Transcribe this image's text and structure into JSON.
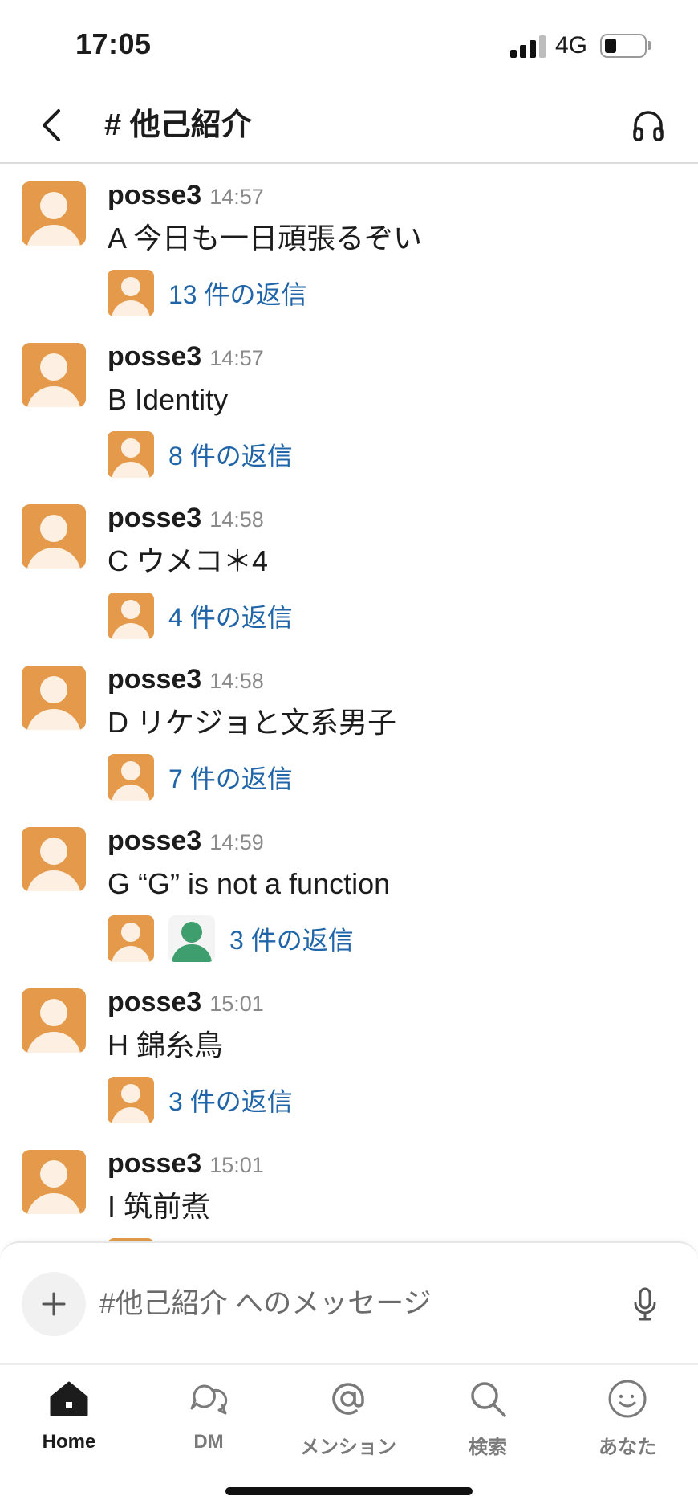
{
  "status_bar": {
    "time": "17:05",
    "network": "4G"
  },
  "header": {
    "channel_title": "# 他己紹介"
  },
  "messages": [
    {
      "user": "posse3",
      "time": "14:57",
      "text": "A  今日も一日頑張るぞい",
      "reply_text": "13 件の返信",
      "participants": [
        "orange"
      ]
    },
    {
      "user": "posse3",
      "time": "14:57",
      "text": "B  Identity",
      "reply_text": "8 件の返信",
      "participants": [
        "orange"
      ]
    },
    {
      "user": "posse3",
      "time": "14:58",
      "text": "C  ウメコ＊4",
      "reply_text": "4 件の返信",
      "participants": [
        "orange"
      ]
    },
    {
      "user": "posse3",
      "time": "14:58",
      "text": "D  リケジョと文系男子",
      "reply_text": "7 件の返信",
      "participants": [
        "orange"
      ]
    },
    {
      "user": "posse3",
      "time": "14:59",
      "text": "G  “G” is not a function",
      "reply_text": "3 件の返信",
      "participants": [
        "orange",
        "green"
      ]
    },
    {
      "user": "posse3",
      "time": "15:01",
      "text": "H  錦糸鳥",
      "reply_text": "3 件の返信",
      "participants": [
        "orange"
      ]
    },
    {
      "user": "posse3",
      "time": "15:01",
      "text": "I  筑前煮",
      "reply_text": "",
      "participants": [
        "orange"
      ]
    }
  ],
  "composer": {
    "placeholder": "#他己紹介 へのメッセージ"
  },
  "tabbar": {
    "tabs": [
      {
        "label": "Home",
        "icon": "home-icon",
        "active": true
      },
      {
        "label": "DM",
        "icon": "dm-icon",
        "active": false
      },
      {
        "label": "メンション",
        "icon": "mention-icon",
        "active": false
      },
      {
        "label": "検索",
        "icon": "search-icon",
        "active": false
      },
      {
        "label": "あなた",
        "icon": "you-icon",
        "active": false
      }
    ]
  },
  "colors": {
    "avatar_orange": "#e49a4a",
    "avatar_green": "#3f9e6e",
    "link_blue": "#1f65a8"
  }
}
